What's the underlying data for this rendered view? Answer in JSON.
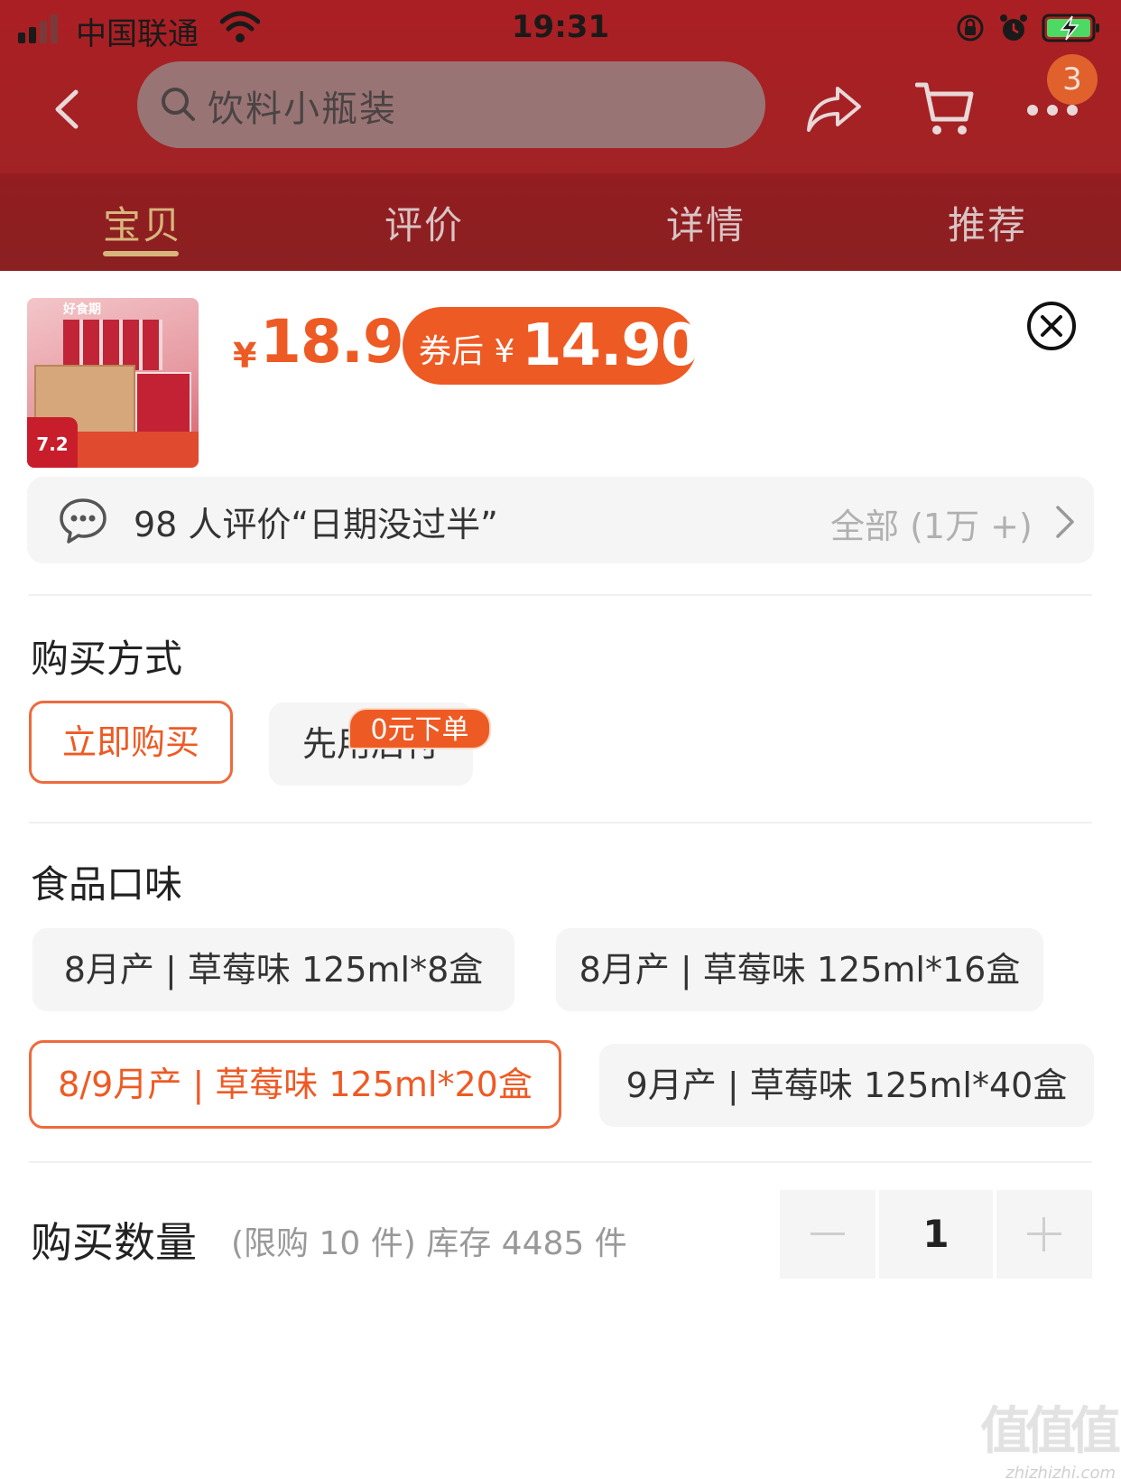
{
  "status_bar": {
    "carrier": "中国联通",
    "time": "19:31"
  },
  "nav": {
    "search_placeholder": "饮料小瓶装",
    "cart_badge": "3",
    "icons": [
      "back-icon",
      "search-icon",
      "share-icon",
      "cart-icon",
      "more-icon"
    ]
  },
  "tabs": [
    {
      "label": "宝贝",
      "active": true
    },
    {
      "label": "评价",
      "active": false
    },
    {
      "label": "详情",
      "active": false
    },
    {
      "label": "推荐",
      "active": false
    }
  ],
  "product": {
    "thumb_brand": "好食期",
    "thumb_price": "7.2",
    "price_symbol": "¥",
    "price": "18.9",
    "coupon_prefix": "券后 ¥",
    "coupon_price": "14.90"
  },
  "reviews": {
    "summary": "98 人评价“日期没过半”",
    "all_label": "全部 (1万 +)"
  },
  "purchase_method": {
    "title": "购买方式",
    "options": [
      {
        "label": "立即购买",
        "selected": true
      },
      {
        "label": "先用后付",
        "selected": false
      }
    ],
    "badge": "0元下单"
  },
  "flavor": {
    "title": "食品口味",
    "options": [
      {
        "label": "8月产 | 草莓味  125ml*8盒",
        "selected": false
      },
      {
        "label": "8月产 | 草莓味 125ml*16盒",
        "selected": false
      },
      {
        "label": "8/9月产 | 草莓味 125ml*20盒",
        "selected": true
      },
      {
        "label": "9月产 | 草莓味 125ml*40盒",
        "selected": false
      }
    ]
  },
  "quantity": {
    "title": "购买数量",
    "note": "(限购 10 件) 库存 4485 件",
    "value": "1"
  },
  "watermark": {
    "logo": "值值值",
    "url": "zhizhizhi.com"
  },
  "colors": {
    "accent": "#ee5a24",
    "header_red": "#c3272b",
    "tab_active": "#d8b57c"
  }
}
